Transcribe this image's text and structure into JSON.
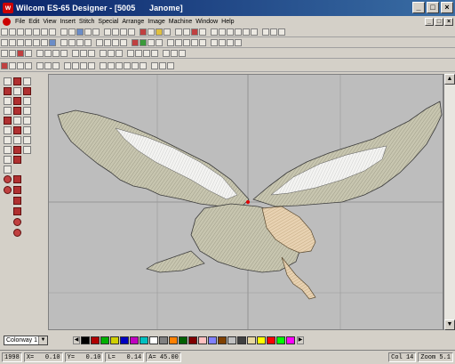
{
  "window": {
    "title": "Wilcom ES-65 Designer - [5005      Janome]"
  },
  "menu": [
    "File",
    "Edit",
    "View",
    "Insert",
    "Stitch",
    "Special",
    "Arrange",
    "Image",
    "Machine",
    "Window",
    "Help"
  ],
  "colorway": {
    "value": "Colorway 1"
  },
  "palette": {
    "colors": [
      "#000000",
      "#b00000",
      "#00b000",
      "#d0d000",
      "#0000c0",
      "#c000c0",
      "#00c0c0",
      "#ffffff",
      "#808080",
      "#ff8000",
      "#006000",
      "#800000",
      "#ffc0c0",
      "#8080ff",
      "#804000",
      "#c0c0c0",
      "#404040",
      "#e8d8a0",
      "#ffff00",
      "#ff0000",
      "#00ff00",
      "#ff00ff"
    ]
  },
  "status": {
    "stitches": "1998",
    "x": "X=   0.10",
    "y": "Y=   0.10",
    "l": "L=   0.14",
    "a": "A= 45.00",
    "col": "Col 14",
    "zoom": "Zoom 5.1"
  },
  "colors": {
    "titlebar": "#0a246a",
    "canvas": "#bdbdbd",
    "eagle_fill": "#c8c6b0",
    "eagle_highlight": "#f0f0f0",
    "eagle_head": "#e8d0b0"
  }
}
